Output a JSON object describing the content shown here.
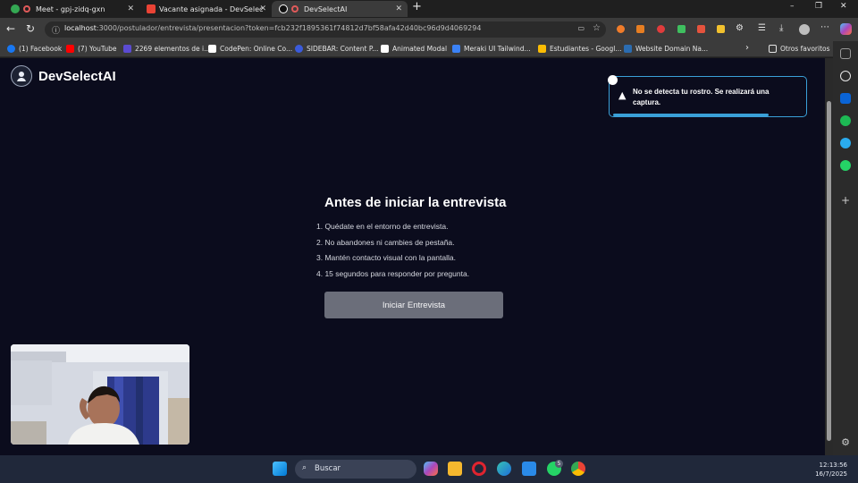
{
  "tabs": [
    {
      "title": "Meet - gpj-zidq-gxn",
      "favicon_color": "#34a853"
    },
    {
      "title": "Vacante asignada - DevSelectAI -",
      "favicon_color": "#ea4335"
    },
    {
      "title": "DevSelectAI",
      "favicon_color": "#ffffff",
      "active": true
    }
  ],
  "new_tab_label": "+",
  "window_controls": {
    "minimize": "–",
    "maximize": "❐",
    "close": "✕"
  },
  "address": {
    "host": "localhost",
    "rest": ":3000/postulador/entrevista/presentacion?token=fcb232f1895361f74812d7bf58afa42d40bc96d9d4069294"
  },
  "bookmarks": [
    {
      "label": "(1) Facebook",
      "color": "#1877f2"
    },
    {
      "label": "(7) YouTube",
      "color": "#ff0000"
    },
    {
      "label": "2269 elementos de i...",
      "color": "#5b4bd1"
    },
    {
      "label": "CodePen: Online Co...",
      "color": "#ffffff"
    },
    {
      "label": "SIDEBAR: Content P...",
      "color": "#3b5bdb"
    },
    {
      "label": "Animated Modal",
      "color": "#ffffff"
    },
    {
      "label": "Meraki UI Tailwind...",
      "color": "#3b82f6"
    },
    {
      "label": "Estudiantes - Googl...",
      "color": "#fbbc04"
    },
    {
      "label": "Website Domain Na...",
      "color": "#2b6cb0"
    }
  ],
  "bookmarks_more": "Otros favoritos",
  "brand": {
    "name": "DevSelectAI"
  },
  "toast": {
    "message": "No se detecta tu rostro. Se realizará una captura.",
    "accent": "#3aa0d8",
    "progress": 0.82
  },
  "intro": {
    "title": "Antes de iniciar la entrevista",
    "steps": [
      "1. Quédate en el entorno de entrevista.",
      "2. No abandones ni cambies de pestaña.",
      "3. Mantén contacto visual con la pantalla.",
      "4. 15 segundos para responder por pregunta."
    ],
    "button": "Iniciar Entrevista"
  },
  "taskbar": {
    "search_label": "Buscar",
    "whatsapp_badge": "5",
    "time": "12:13:56",
    "date": "16/7/2025"
  }
}
